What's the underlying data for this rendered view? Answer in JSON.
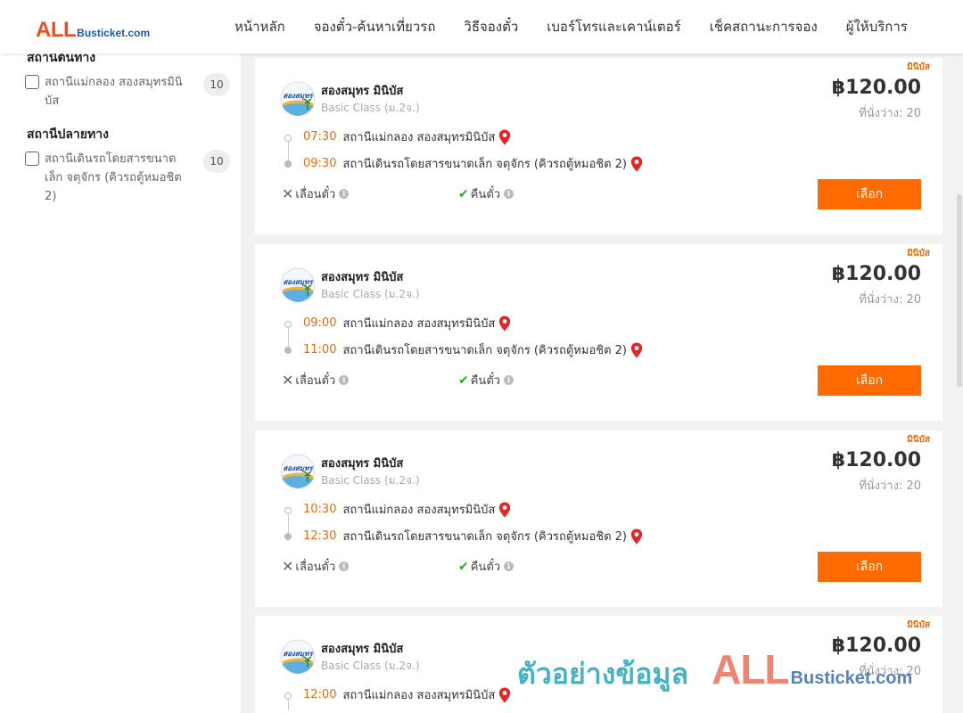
{
  "header": {
    "logo_all": "ALL",
    "logo_rest": "Busticket.com",
    "nav": [
      "หน้าหลัก",
      "จองตั๋ว-ค้นหาเที่ยวรถ",
      "วิธีจองตั๋ว",
      "เบอร์โทรและเคาน์เตอร์",
      "เช็คสถานะการจอง",
      "ผู้ให้บริการ"
    ]
  },
  "sidebar": {
    "origin_title": "สถานีต้นทาง",
    "origin_items": [
      {
        "label": "สถานีแม่กลอง สองสมุทรมินิบัส",
        "count": "10",
        "checked": false
      }
    ],
    "dest_title": "สถานีปลายทาง",
    "dest_items": [
      {
        "label": "สถานีเดินรถโดยสารขนาดเล็ก จตุจักร (คิวรถตู้หมอชิต 2)",
        "count": "10",
        "checked": false
      }
    ]
  },
  "trips": [
    {
      "badge": "มินิบัส",
      "operator": "สองสมุทร มินิบัส",
      "class": "Basic Class (ม.2จ.)",
      "price": "฿120.00",
      "seats": "ที่นั่งว่าง: 20",
      "depart_time": "07:30",
      "depart_station": "สถานีแม่กลอง สองสมุทรมินิบัส",
      "arrive_time": "09:30",
      "arrive_station": "สถานีเดินรถโดยสารขนาดเล็ก จตุจักร (คิวรถตู้หมอชิต 2)",
      "change_label": "เลื่อนตั๋ว",
      "refund_label": "คืนตั๋ว",
      "select_label": "เลือก"
    },
    {
      "badge": "มินิบัส",
      "operator": "สองสมุทร มินิบัส",
      "class": "Basic Class (ม.2จ.)",
      "price": "฿120.00",
      "seats": "ที่นั่งว่าง: 20",
      "depart_time": "09:00",
      "depart_station": "สถานีแม่กลอง สองสมุทรมินิบัส",
      "arrive_time": "11:00",
      "arrive_station": "สถานีเดินรถโดยสารขนาดเล็ก จตุจักร (คิวรถตู้หมอชิต 2)",
      "change_label": "เลื่อนตั๋ว",
      "refund_label": "คืนตั๋ว",
      "select_label": "เลือก"
    },
    {
      "badge": "มินิบัส",
      "operator": "สองสมุทร มินิบัส",
      "class": "Basic Class (ม.2จ.)",
      "price": "฿120.00",
      "seats": "ที่นั่งว่าง: 20",
      "depart_time": "10:30",
      "depart_station": "สถานีแม่กลอง สองสมุทรมินิบัส",
      "arrive_time": "12:30",
      "arrive_station": "สถานีเดินรถโดยสารขนาดเล็ก จตุจักร (คิวรถตู้หมอชิต 2)",
      "change_label": "เลื่อนตั๋ว",
      "refund_label": "คืนตั๋ว",
      "select_label": "เลือก"
    },
    {
      "badge": "มินิบัส",
      "operator": "สองสมุทร มินิบัส",
      "class": "Basic Class (ม.2จ.)",
      "price": "฿120.00",
      "seats": "ที่นั่งว่าง: 20",
      "depart_time": "12:00",
      "depart_station": "สถานีแม่กลอง สองสมุทรมินิบัส",
      "arrive_time": "",
      "arrive_station": "",
      "change_label": "",
      "refund_label": "",
      "select_label": ""
    }
  ],
  "watermark": {
    "text": "ตัวอย่างข้อมูล",
    "logo_all": "ALL",
    "logo_rest": "Busticket.com"
  },
  "colors": {
    "accent": "#ff6a00",
    "time": "#e86a10",
    "logo_red": "#e94e24",
    "logo_blue": "#1f5aa6",
    "pin": "#e02828",
    "refund_ok": "#2ba52b"
  }
}
